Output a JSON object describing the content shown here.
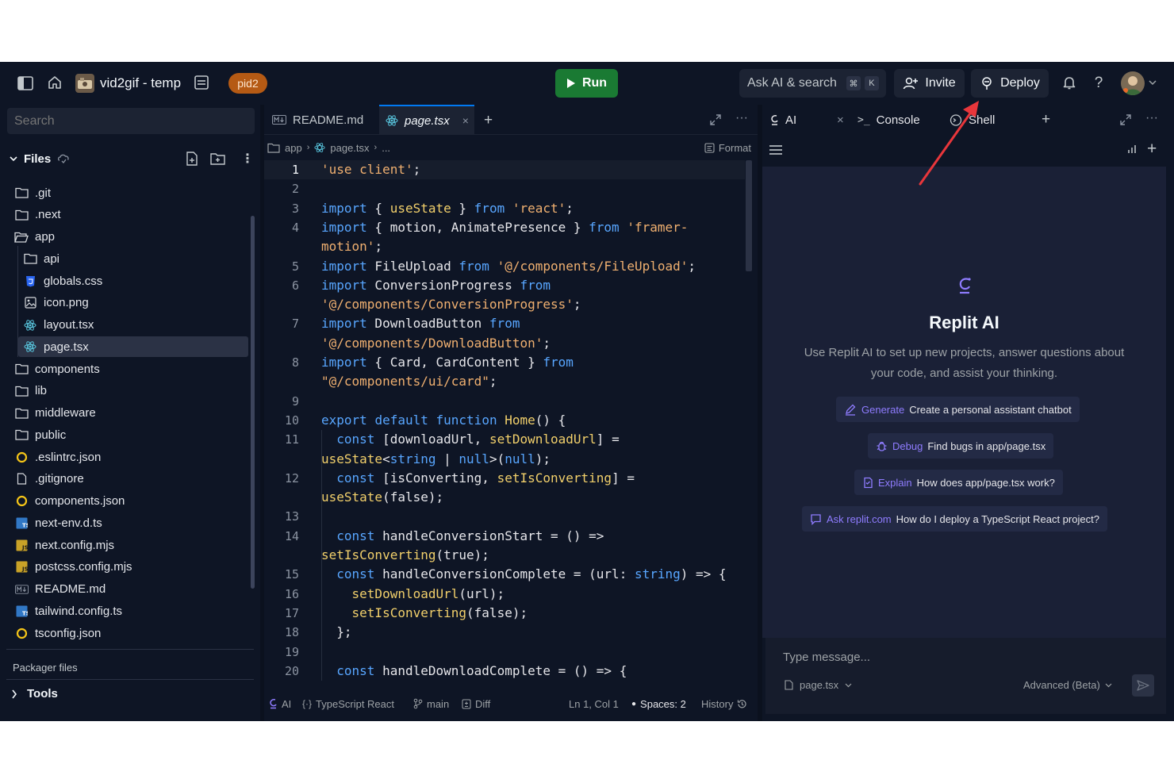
{
  "topbar": {
    "project_name": "vid2gif - temp",
    "pid_badge": "pid2",
    "run_label": "Run",
    "ask_ai_label": "Ask AI & search",
    "ask_ai_shortcut": [
      "⌘",
      "K"
    ],
    "invite_label": "Invite",
    "deploy_label": "Deploy"
  },
  "sidebar": {
    "search_placeholder": "Search",
    "files_label": "Files",
    "tree": [
      {
        "name": ".git",
        "type": "folder"
      },
      {
        "name": ".next",
        "type": "folder"
      },
      {
        "name": "app",
        "type": "folder-open"
      },
      {
        "name": "api",
        "type": "folder"
      },
      {
        "name": "globals.css",
        "type": "css"
      },
      {
        "name": "icon.png",
        "type": "image"
      },
      {
        "name": "layout.tsx",
        "type": "react"
      },
      {
        "name": "page.tsx",
        "type": "react"
      },
      {
        "name": "components",
        "type": "folder"
      },
      {
        "name": "lib",
        "type": "folder"
      },
      {
        "name": "middleware",
        "type": "folder"
      },
      {
        "name": "public",
        "type": "folder"
      },
      {
        "name": ".eslintrc.json",
        "type": "json"
      },
      {
        "name": ".gitignore",
        "type": "file"
      },
      {
        "name": "components.json",
        "type": "json"
      },
      {
        "name": "next-env.d.ts",
        "type": "ts"
      },
      {
        "name": "next.config.mjs",
        "type": "js"
      },
      {
        "name": "postcss.config.mjs",
        "type": "js"
      },
      {
        "name": "README.md",
        "type": "md"
      },
      {
        "name": "tailwind.config.ts",
        "type": "ts"
      },
      {
        "name": "tsconfig.json",
        "type": "json"
      }
    ],
    "packager_label": "Packager files",
    "tools_label": "Tools"
  },
  "editor": {
    "tabs": [
      {
        "label": "README.md",
        "active": false
      },
      {
        "label": "page.tsx",
        "active": true
      }
    ],
    "breadcrumbs": [
      "app",
      "page.tsx",
      "..."
    ],
    "format_label": "Format",
    "lines": [
      {
        "n": "1",
        "t": "'use client';"
      },
      {
        "n": "2",
        "t": ""
      },
      {
        "n": "3",
        "t": "import { useState } from 'react';"
      },
      {
        "n": "4",
        "t": "import { motion, AnimatePresence } from 'framer-"
      },
      {
        "n": "",
        "t": "motion';"
      },
      {
        "n": "5",
        "t": "import FileUpload from '@/components/FileUpload';"
      },
      {
        "n": "6",
        "t": "import ConversionProgress from"
      },
      {
        "n": "",
        "t": "'@/components/ConversionProgress';"
      },
      {
        "n": "7",
        "t": "import DownloadButton from"
      },
      {
        "n": "",
        "t": "'@/components/DownloadButton';"
      },
      {
        "n": "8",
        "t": "import { Card, CardContent } from"
      },
      {
        "n": "",
        "t": "\"@/components/ui/card\";"
      },
      {
        "n": "9",
        "t": ""
      },
      {
        "n": "10",
        "t": "export default function Home() {"
      },
      {
        "n": "11",
        "t": "  const [downloadUrl, setDownloadUrl] ="
      },
      {
        "n": "",
        "t": "useState<string | null>(null);"
      },
      {
        "n": "12",
        "t": "  const [isConverting, setIsConverting] ="
      },
      {
        "n": "",
        "t": "useState(false);"
      },
      {
        "n": "13",
        "t": ""
      },
      {
        "n": "14",
        "t": "  const handleConversionStart = () =>"
      },
      {
        "n": "",
        "t": "setIsConverting(true);"
      },
      {
        "n": "15",
        "t": "  const handleConversionComplete = (url: string) => {"
      },
      {
        "n": "16",
        "t": "    setDownloadUrl(url);"
      },
      {
        "n": "17",
        "t": "    setIsConverting(false);"
      },
      {
        "n": "18",
        "t": "  };"
      },
      {
        "n": "19",
        "t": ""
      },
      {
        "n": "20",
        "t": "  const handleDownloadComplete = () => {"
      }
    ],
    "status": {
      "ai": "AI",
      "language": "TypeScript React",
      "branch": "main",
      "diff": "Diff",
      "cursor": "Ln 1, Col 1",
      "spaces": "Spaces: 2",
      "history": "History"
    }
  },
  "right_panel": {
    "tabs": [
      {
        "label": "AI"
      },
      {
        "label": "Console"
      },
      {
        "label": "Shell"
      }
    ],
    "title": "Replit AI",
    "description": "Use Replit AI to set up new projects, answer questions about your code, and assist your thinking.",
    "suggestions": [
      {
        "key": "Generate",
        "text": "Create a personal assistant chatbot"
      },
      {
        "key": "Debug",
        "text": "Find bugs in app/page.tsx"
      },
      {
        "key": "Explain",
        "text": "How does app/page.tsx work?"
      },
      {
        "key": "Ask replit.com",
        "text": "How do I deploy a TypeScript React project?"
      }
    ],
    "message_placeholder": "Type message...",
    "context_file": "page.tsx",
    "mode_label": "Advanced (Beta)"
  },
  "colors": {
    "background": "#0e1525",
    "surface": "#1c2333",
    "run_green": "#1a7a33",
    "pid_orange": "#b55a14",
    "ai_purple": "#8f7cff",
    "annotation_red": "#e8363b"
  }
}
